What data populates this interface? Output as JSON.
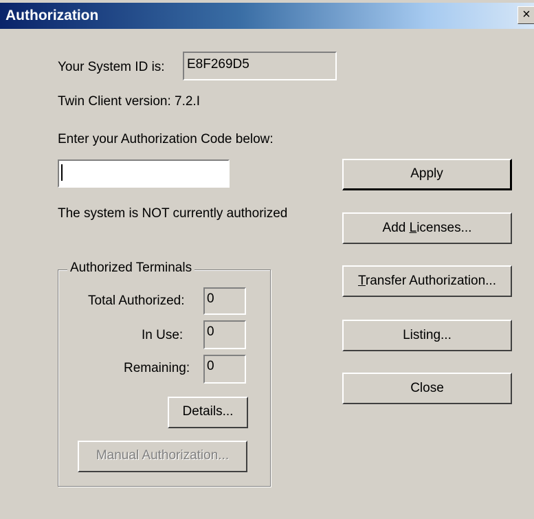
{
  "window": {
    "title": "Authorization",
    "close_glyph": "×"
  },
  "system_id": {
    "label": "Your System ID is:",
    "value": "E8F269D5"
  },
  "version": {
    "label": "Twin Client version: 7.2.I"
  },
  "auth_code": {
    "label": "Enter your Authorization Code below:",
    "value": ""
  },
  "status": {
    "text": "The system is NOT currently authorized"
  },
  "terminals": {
    "legend": "Authorized Terminals",
    "total_label": "Total Authorized:",
    "total_value": "0",
    "in_use_label": "In Use:",
    "in_use_value": "0",
    "remaining_label": "Remaining:",
    "remaining_value": "0",
    "details_button": "Details...",
    "manual_button": "Manual Authorization..."
  },
  "buttons": {
    "apply": "Apply",
    "add_licenses_pre": "Add ",
    "add_licenses_u": "L",
    "add_licenses_post": "icenses...",
    "transfer_u": "T",
    "transfer_post": "ransfer Authorization...",
    "listing": "Listing...",
    "close": "Close"
  },
  "icons": {
    "close": "close-icon"
  }
}
